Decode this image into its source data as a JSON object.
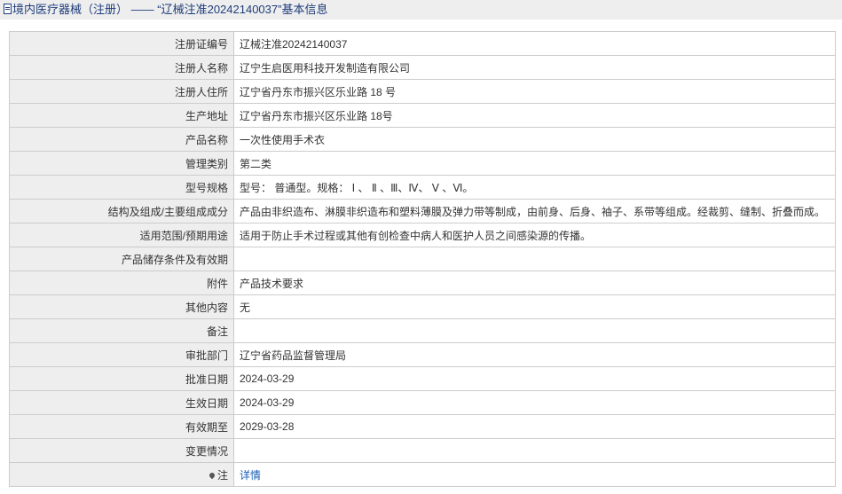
{
  "header": {
    "icon": "document-icon",
    "prefix": "境内医疗器械（注册）",
    "dash": "——",
    "title": "“辽械注准20242140037”基本信息"
  },
  "rows": [
    {
      "label": "注册证编号",
      "value": "辽械注准20242140037"
    },
    {
      "label": "注册人名称",
      "value": "辽宁生启医用科技开发制造有限公司"
    },
    {
      "label": "注册人住所",
      "value": "辽宁省丹东市振兴区乐业路 18 号"
    },
    {
      "label": "生产地址",
      "value": "辽宁省丹东市振兴区乐业路 18号"
    },
    {
      "label": "产品名称",
      "value": "一次性使用手术衣"
    },
    {
      "label": "管理类别",
      "value": "第二类"
    },
    {
      "label": "型号规格",
      "value": "型号： 普通型。规格： Ⅰ 、 Ⅱ 、Ⅲ、Ⅳ、 Ⅴ 、Ⅵ。"
    },
    {
      "label": "结构及组成/主要组成成分",
      "value": "产品由非织造布、淋膜非织造布和塑料薄膜及弹力带等制成，由前身、后身、袖子、系带等组成。经裁剪、缝制、折叠而成。"
    },
    {
      "label": "适用范围/预期用途",
      "value": "适用于防止手术过程或其他有创检查中病人和医护人员之间感染源的传播。"
    },
    {
      "label": "产品储存条件及有效期",
      "value": ""
    },
    {
      "label": "附件",
      "value": "产品技术要求"
    },
    {
      "label": "其他内容",
      "value": "无"
    },
    {
      "label": "备注",
      "value": ""
    },
    {
      "label": "审批部门",
      "value": "辽宁省药品监督管理局"
    },
    {
      "label": "批准日期",
      "value": "2024-03-29"
    },
    {
      "label": "生效日期",
      "value": "2024-03-29"
    },
    {
      "label": "有效期至",
      "value": "2029-03-28"
    },
    {
      "label": "变更情况",
      "value": ""
    },
    {
      "label": "注",
      "value": "详情",
      "icon": "pin-icon"
    }
  ]
}
